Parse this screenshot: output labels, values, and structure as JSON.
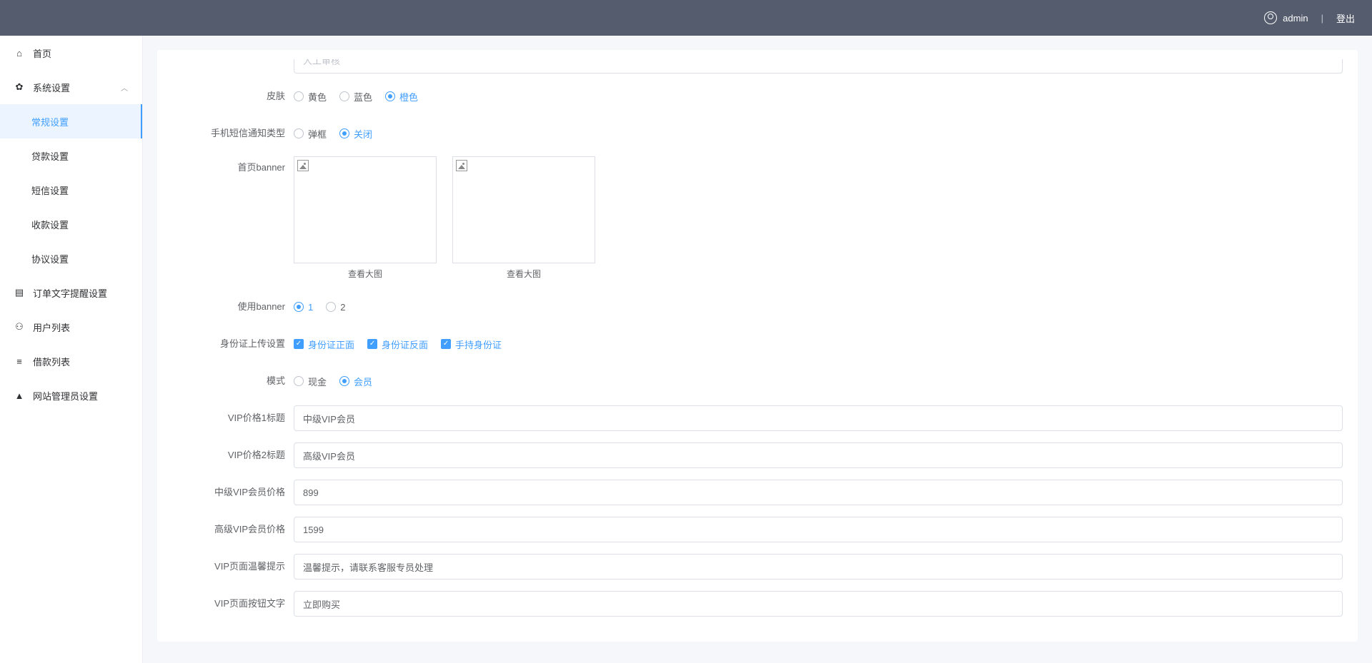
{
  "header": {
    "username": "admin",
    "divider": "|",
    "logout": "登出"
  },
  "sidebar": {
    "home": "首页",
    "system": "系统设置",
    "sub": {
      "general": "常规设置",
      "loan": "贷款设置",
      "sms": "短信设置",
      "receipt": "收款设置",
      "agreement": "协议设置"
    },
    "order_reminder": "订单文字提醒设置",
    "users": "用户列表",
    "loans": "借款列表",
    "admins": "网站管理员设置"
  },
  "form": {
    "cutoff_hidden_label": "……",
    "cutoff_hidden_value": "人工审核",
    "skin": {
      "label": "皮肤",
      "options": [
        "黄色",
        "蓝色",
        "橙色"
      ],
      "selected": "橙色"
    },
    "sms_notify": {
      "label": "手机短信通知类型",
      "options": [
        "弹框",
        "关闭"
      ],
      "selected": "关闭"
    },
    "banner": {
      "label": "首页banner",
      "view_big_1": "查看大图",
      "view_big_2": "查看大图"
    },
    "use_banner": {
      "label": "使用banner",
      "options": [
        "1",
        "2"
      ],
      "selected": "1"
    },
    "id_upload": {
      "label": "身份证上传设置",
      "options": [
        "身份证正面",
        "身份证反面",
        "手持身份证"
      ],
      "checked": [
        true,
        true,
        true
      ]
    },
    "mode": {
      "label": "模式",
      "options": [
        "现金",
        "会员"
      ],
      "selected": "会员"
    },
    "vip1_title": {
      "label": "VIP价格1标题",
      "value": "中级VIP会员"
    },
    "vip2_title": {
      "label": "VIP价格2标题",
      "value": "高级VIP会员"
    },
    "mid_vip_price": {
      "label": "中级VIP会员价格",
      "value": "899"
    },
    "high_vip_price": {
      "label": "高级VIP会员价格",
      "value": "1599"
    },
    "vip_tip": {
      "label": "VIP页面温馨提示",
      "value": "温馨提示，请联系客服专员处理"
    },
    "vip_btn_text": {
      "label": "VIP页面按钮文字",
      "value": "立即购买"
    }
  }
}
